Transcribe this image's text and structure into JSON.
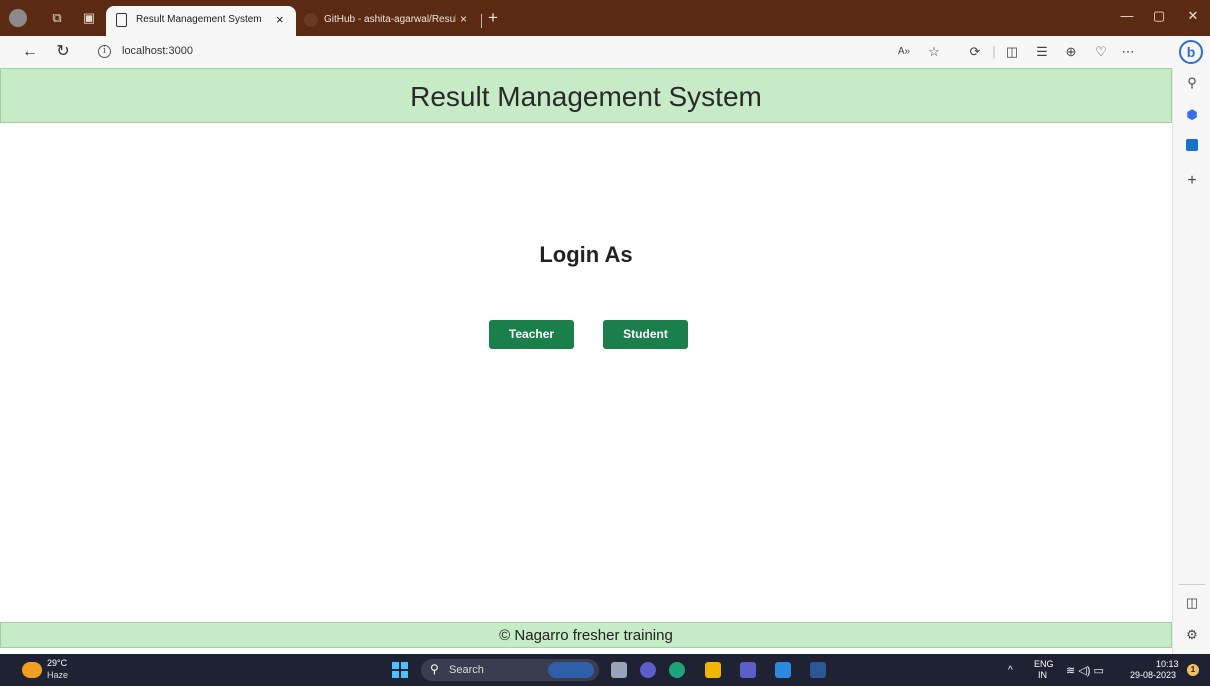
{
  "browser": {
    "active_tab_title": "Result Management System",
    "inactive_tab_title": "GitHub - ashita-agarwal/Result-M",
    "url": "localhost:3000",
    "close_glyph": "×",
    "new_tab_glyph": "+"
  },
  "app": {
    "header_title": "Result Management System",
    "login_heading": "Login As",
    "buttons": {
      "teacher": "Teacher",
      "student": "Student"
    },
    "footer_text": "© Nagarro fresher training"
  },
  "taskbar": {
    "weather_temp": "29°C",
    "weather_desc": "Haze",
    "search_placeholder": "Search",
    "language_top": "ENG",
    "language_bottom": "IN",
    "time": "10:13",
    "date": "29-08-2023",
    "notification_count": "1"
  },
  "colors": {
    "header_bg": "#c6ebc6",
    "button_bg": "#1a7f4b",
    "titlebar_bg": "#5a2a12",
    "taskbar_bg": "#1f2233"
  }
}
